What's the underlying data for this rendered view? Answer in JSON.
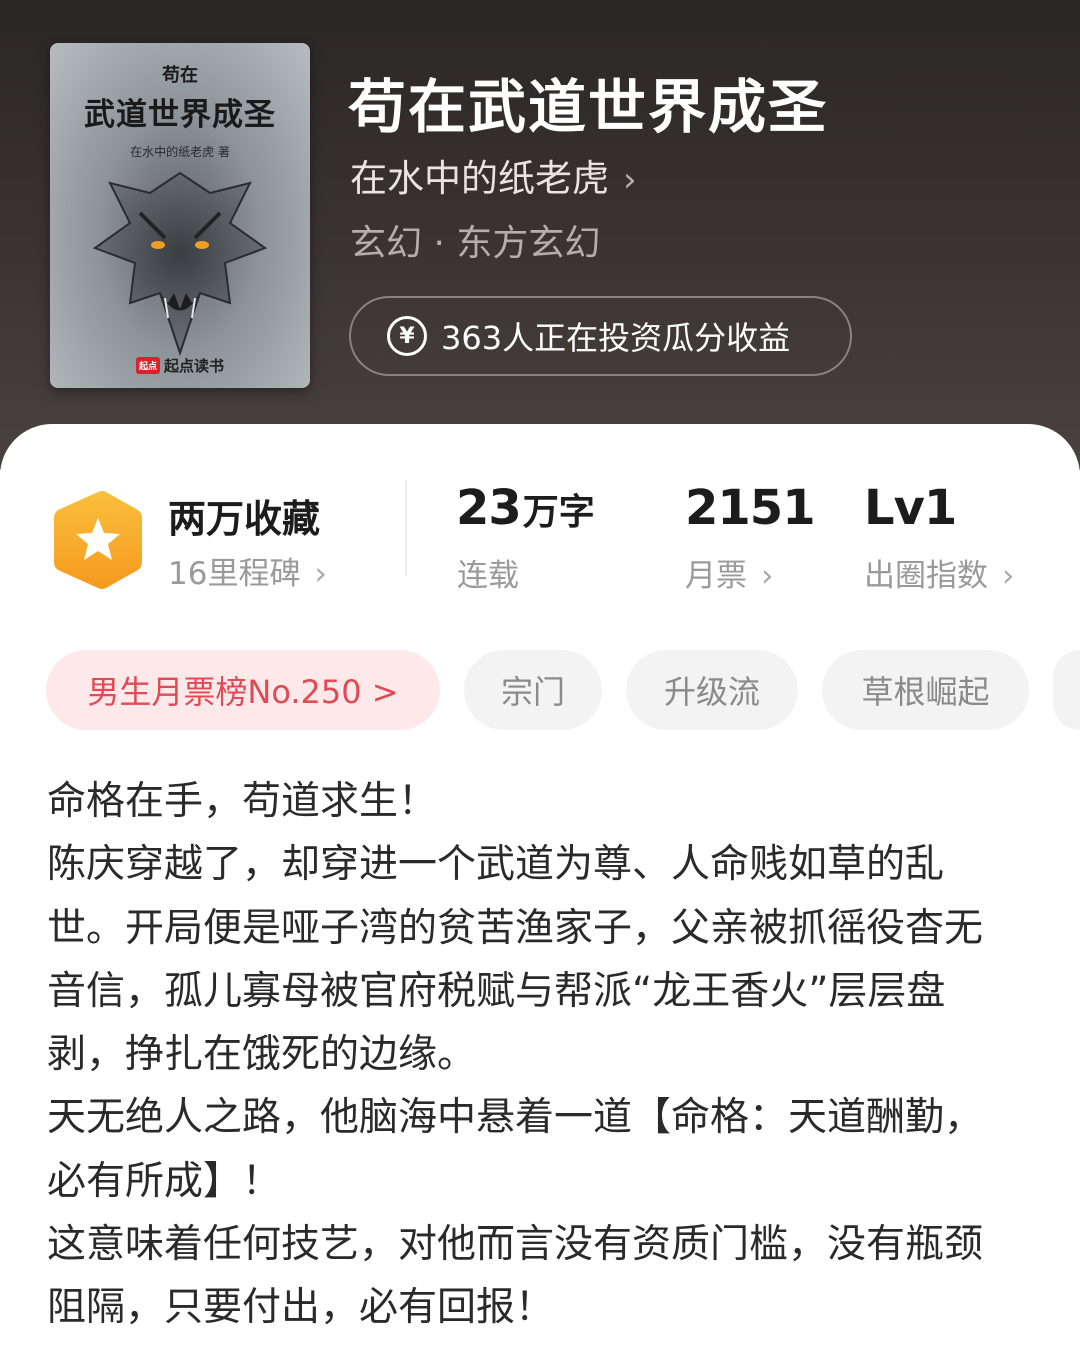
{
  "book": {
    "cover": {
      "small_title": "苟在",
      "title": "武道世界成圣",
      "author_line": "在水中的纸老虎 著",
      "brand": "起点读书",
      "brand_mark": "起点"
    },
    "title": "苟在武道世界成圣",
    "author": "在水中的纸老虎",
    "genre": "玄幻 · 东方玄幻",
    "invest_text": "363人正在投资瓜分收益"
  },
  "stats": {
    "favorites": "两万收藏",
    "milestones": "16里程碑",
    "word_count": "23",
    "word_unit": "万字",
    "status": "连载",
    "monthly_votes": "2151",
    "monthly_votes_label": "月票",
    "level": "Lv1",
    "level_label": "出圈指数"
  },
  "tags": [
    {
      "label": "男生月票榜No.250 >"
    },
    {
      "label": "宗门"
    },
    {
      "label": "升级流"
    },
    {
      "label": "草根崛起"
    }
  ],
  "synopsis": [
    "命格在手，苟道求生！",
    "陈庆穿越了，却穿进一个武道为尊、人命贱如草的乱世。开局便是哑子湾的贫苦渔家子，父亲被抓徭役杳无音信，孤儿寡母被官府税赋与帮派“龙王香火”层层盘剥，挣扎在饿死的边缘。",
    "天无绝人之路，他脑海中悬着一道【命格：天道酬勤，必有所成】！",
    "这意味着任何技艺，对他而言没有资质门槛，没有瓶颈阻隔，只要付出，必有回报！"
  ],
  "colors": {
    "hero_bg": "#2b2726",
    "rank_tag_text": "#e04a55",
    "rank_tag_bg": "#fde9ea",
    "hex_icon": "#f7a92a"
  },
  "icons": [
    "yen-circle-icon",
    "star-hexagon-icon",
    "chevron-right-icon",
    "dragon-cover-art"
  ]
}
